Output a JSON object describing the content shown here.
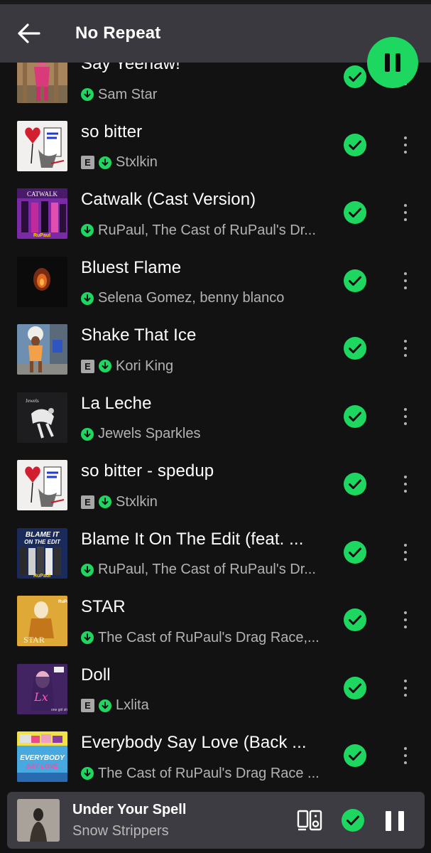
{
  "header": {
    "title": "No Repeat"
  },
  "colors": {
    "accent": "#1ed760",
    "background": "#121212",
    "header_bg": "#3a3940",
    "miniplayer_bg": "#3d3c42"
  },
  "tracks": [
    {
      "title": "Say Yeehaw!",
      "artist": "Sam Star",
      "explicit": false,
      "art": "art-pink-figure"
    },
    {
      "title": "so bitter",
      "artist": "Stxlkin",
      "explicit": true,
      "art": "art-heart-sketch"
    },
    {
      "title": "Catwalk (Cast Version)",
      "artist": "RuPaul, The Cast of RuPaul's Dr...",
      "explicit": false,
      "art": "art-catwalk-purple"
    },
    {
      "title": "Bluest Flame",
      "artist": "Selena Gomez, benny blanco",
      "explicit": false,
      "art": "art-dark-flame"
    },
    {
      "title": "Shake That Ice",
      "artist": "Kori King",
      "explicit": true,
      "art": "art-street-figure"
    },
    {
      "title": "La Leche",
      "artist": "Jewels Sparkles",
      "explicit": false,
      "art": "art-dark-figure"
    },
    {
      "title": "so bitter - spedup",
      "artist": "Stxlkin",
      "explicit": true,
      "art": "art-heart-sketch"
    },
    {
      "title": "Blame It On The Edit (feat. ...",
      "artist": "RuPaul, The Cast of RuPaul's Dr...",
      "explicit": false,
      "art": "art-blame-edit"
    },
    {
      "title": "STAR",
      "artist": "The Cast of RuPaul's Drag Race,...",
      "explicit": false,
      "art": "art-star-gold"
    },
    {
      "title": "Doll",
      "artist": "Lxlita",
      "explicit": true,
      "art": "art-doll-pink"
    },
    {
      "title": "Everybody Say Love (Back ...",
      "artist": "The Cast of RuPaul's Drag Race ...",
      "explicit": false,
      "art": "art-say-love"
    }
  ],
  "now_playing": {
    "title": "Under Your Spell",
    "artist": "Snow Strippers"
  },
  "icons": {
    "back": "arrow-left-icon",
    "pause": "pause-icon",
    "downloaded": "download-done-icon",
    "added": "check-circle-icon",
    "more": "more-vertical-icon",
    "devices": "device-speaker-icon"
  }
}
